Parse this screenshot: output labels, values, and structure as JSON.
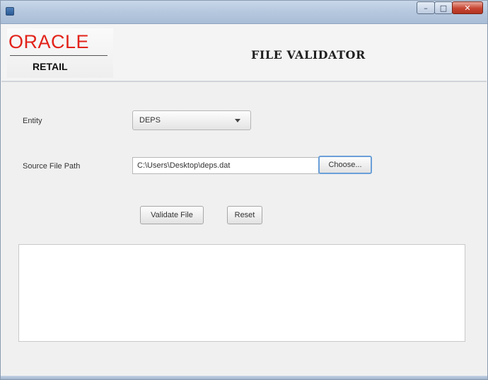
{
  "window": {
    "title": "",
    "controls": {
      "minimize": "–",
      "maximize": "□",
      "close": "✕"
    }
  },
  "header": {
    "logo_brand": "ORACLE",
    "logo_product": "RETAIL",
    "title": "FILE VALIDATOR"
  },
  "form": {
    "entity_label": "Entity",
    "entity_value": "DEPS",
    "source_label": "Source File Path",
    "source_value": "C:\\Users\\Desktop\\deps.dat",
    "choose_label": "Choose...",
    "validate_label": "Validate File",
    "reset_label": "Reset",
    "output_text": ""
  },
  "colors": {
    "oracle_red": "#e2231a",
    "focus_blue": "#6a9fd8"
  }
}
